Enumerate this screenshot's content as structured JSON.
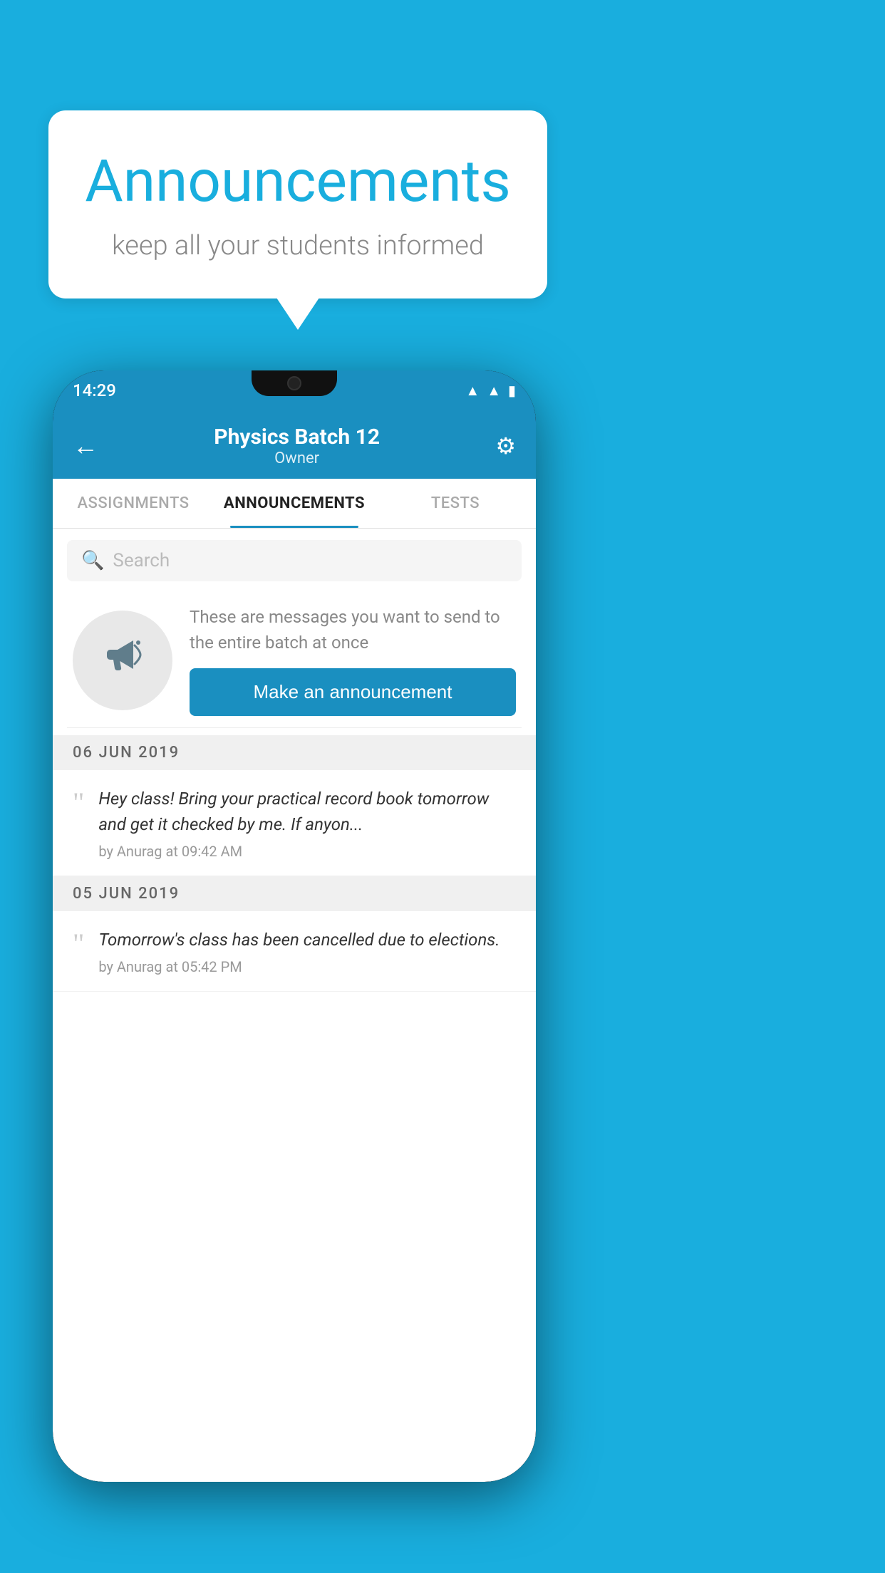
{
  "background": {
    "color": "#19AEDE"
  },
  "speech_bubble": {
    "title": "Announcements",
    "subtitle": "keep all your students informed"
  },
  "phone": {
    "status_bar": {
      "time": "14:29",
      "icons": [
        "wifi",
        "signal",
        "battery"
      ]
    },
    "header": {
      "back_icon": "←",
      "title": "Physics Batch 12",
      "subtitle": "Owner",
      "gear_icon": "⚙"
    },
    "tabs": [
      {
        "label": "ASSIGNMENTS",
        "active": false
      },
      {
        "label": "ANNOUNCEMENTS",
        "active": true
      },
      {
        "label": "TESTS",
        "active": false
      }
    ],
    "search": {
      "placeholder": "Search"
    },
    "promo": {
      "icon": "📣",
      "description": "These are messages you want to send to the entire batch at once",
      "button_label": "Make an announcement"
    },
    "announcements": [
      {
        "date": "06  JUN  2019",
        "items": [
          {
            "text": "Hey class! Bring your practical record book tomorrow and get it checked by me. If anyon...",
            "meta": "by Anurag at 09:42 AM"
          }
        ]
      },
      {
        "date": "05  JUN  2019",
        "items": [
          {
            "text": "Tomorrow's class has been cancelled due to elections.",
            "meta": "by Anurag at 05:42 PM"
          }
        ]
      }
    ]
  }
}
